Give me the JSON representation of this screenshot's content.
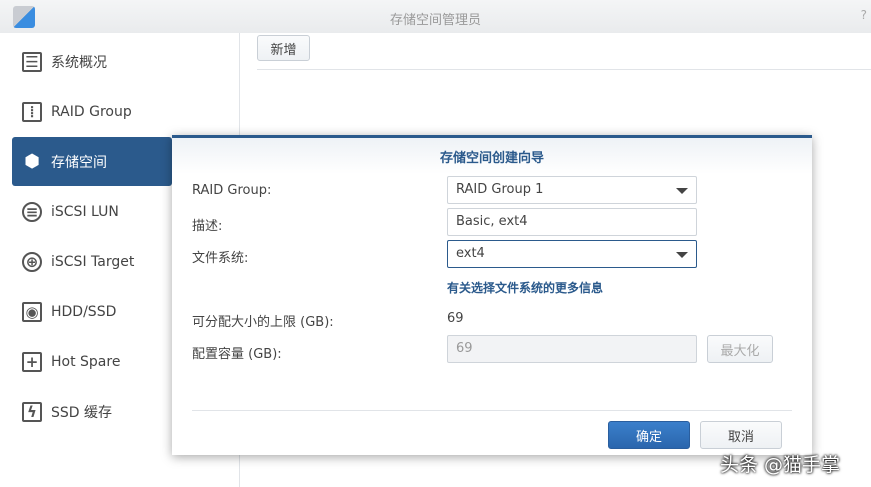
{
  "window": {
    "title": "存储空间管理员",
    "help": "?"
  },
  "sidebar": {
    "items": [
      {
        "label": "系统概况",
        "icon": "overview-icon",
        "glyph": "☰"
      },
      {
        "label": "RAID Group",
        "icon": "raid-icon",
        "glyph": "⦙"
      },
      {
        "label": "存储空间",
        "icon": "cubes-icon",
        "glyph": "⬢"
      },
      {
        "label": "iSCSI LUN",
        "icon": "database-icon",
        "glyph": "≡"
      },
      {
        "label": "iSCSI Target",
        "icon": "globe-icon",
        "glyph": "⊕"
      },
      {
        "label": "HDD/SSD",
        "icon": "disk-icon",
        "glyph": "◉"
      },
      {
        "label": "Hot Spare",
        "icon": "plus-icon",
        "glyph": "+"
      },
      {
        "label": "SSD 缓存",
        "icon": "bolt-icon",
        "glyph": "ϟ"
      }
    ]
  },
  "toolbar": {
    "add": "新增"
  },
  "dialog": {
    "title": "存储空间创建向导",
    "raid_label": "RAID Group:",
    "raid_value": "RAID Group 1",
    "desc_label": "描述:",
    "desc_value": "Basic, ext4",
    "fs_label": "文件系统:",
    "fs_value": "ext4",
    "link": "有关选择文件系统的更多信息",
    "max_label": "可分配大小的上限 (GB):",
    "max_value": "69",
    "cap_label": "配置容量 (GB):",
    "cap_value": "69",
    "maximize": "最大化",
    "ok": "确定",
    "cancel": "取消"
  },
  "watermark": "头条 @猫手掌"
}
